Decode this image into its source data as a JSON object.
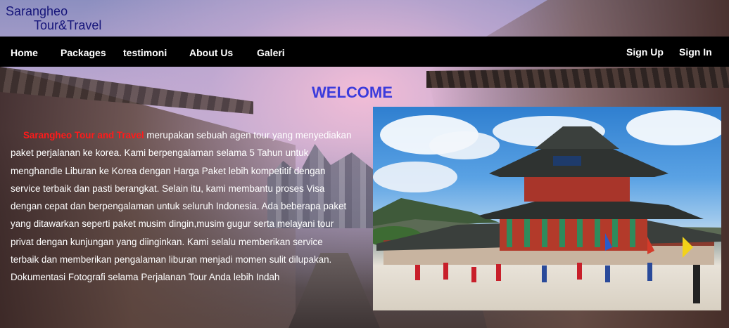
{
  "logo": {
    "line1": "Sarangheo",
    "line2": "Tour&Travel"
  },
  "nav": {
    "items": [
      {
        "label": "Home"
      },
      {
        "label": "Packages"
      },
      {
        "label": "testimoni"
      },
      {
        "label": "About Us"
      },
      {
        "label": "Galeri"
      }
    ],
    "sign_up": "Sign Up",
    "sign_in": "Sign In"
  },
  "welcome": "WELCOME",
  "intro": {
    "brand": "Sarangheo Tour and Travel",
    "text": " merupakan sebuah agen tour yang menyediakan paket perjalanan ke korea. Kami berpengalaman selama 5 Tahun untuk menghandle Liburan ke Korea dengan Harga Paket lebih kompetitif dengan service terbaik dan pasti berangkat. Selain itu, kami membantu proses Visa dengan cepat dan berpengalaman untuk seluruh Indonesia. Ada beberapa paket yang ditawarkan seperti paket musim dingin,musim gugur serta melayani tour privat dengan kunjungan yang diinginkan. Kami selalu memberikan service terbaik dan memberikan pengalaman liburan menjadi momen sulit dilupakan. Dokumentasi Fotografi selama Perjalanan Tour Anda lebih Indah"
  },
  "colors": {
    "navbar": "#000000",
    "welcome": "#3b3bdc",
    "brand_highlight": "#ff1a1a",
    "logo": "#16157a"
  },
  "photo": {
    "icon": "palace-photo"
  }
}
